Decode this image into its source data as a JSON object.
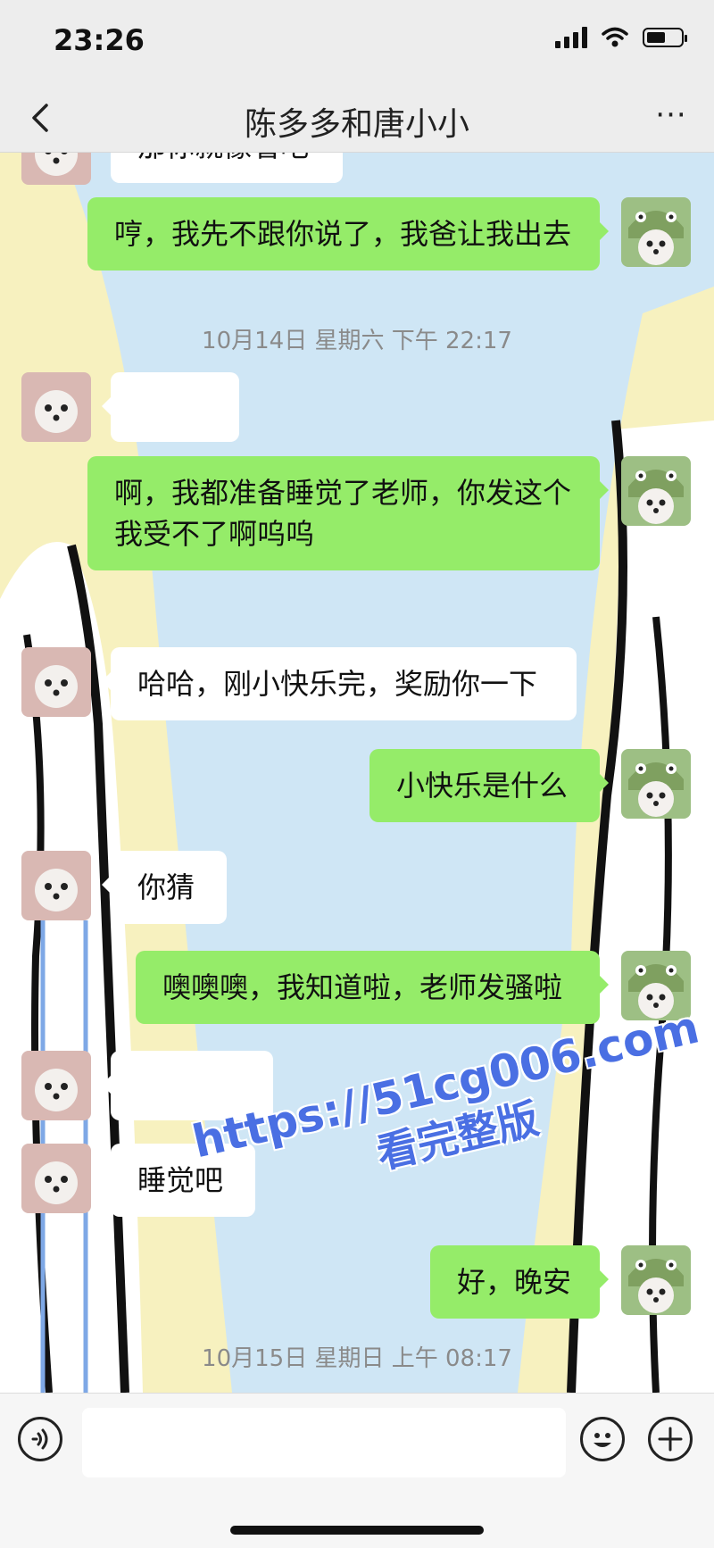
{
  "status_bar": {
    "time": "23:26",
    "battery_level": 0.55
  },
  "header": {
    "title": "陈多多和唐小小",
    "back_icon": "chevron-left-icon",
    "more_icon": "ellipsis-icon",
    "more_label": "···"
  },
  "colors": {
    "sent_bubble": "#95ec69",
    "received_bubble": "#ffffff",
    "background": "#ededed",
    "watermark": "#4a6fe3"
  },
  "messages": [
    {
      "side": "left",
      "text": "那你就像看吧"
    },
    {
      "side": "right",
      "text": "哼，我先不跟你说了，我爸让我出去"
    },
    {
      "type": "timestamp",
      "text": "10月14日 星期六 下午 22:17"
    },
    {
      "side": "left",
      "text": ""
    },
    {
      "side": "right",
      "text": "啊，我都准备睡觉了老师，你发这个我受不了啊呜呜"
    },
    {
      "side": "left",
      "text": "哈哈，刚小快乐完，奖励你一下"
    },
    {
      "side": "right",
      "text": "小快乐是什么"
    },
    {
      "side": "left",
      "text": "你猜"
    },
    {
      "side": "right",
      "text": "噢噢噢，我知道啦，老师发骚啦"
    },
    {
      "side": "left",
      "text": ""
    },
    {
      "side": "left",
      "text": "睡觉吧"
    },
    {
      "side": "right",
      "text": "好，晚安"
    },
    {
      "type": "timestamp",
      "text": "10月15日 星期日 上午 08:17"
    }
  ],
  "watermark": {
    "url": "https://51cg006.com",
    "subtitle": "看完整版"
  },
  "input_bar": {
    "voice_icon": "voice-icon",
    "emoji_icon": "emoji-icon",
    "plus_icon": "plus-icon"
  }
}
